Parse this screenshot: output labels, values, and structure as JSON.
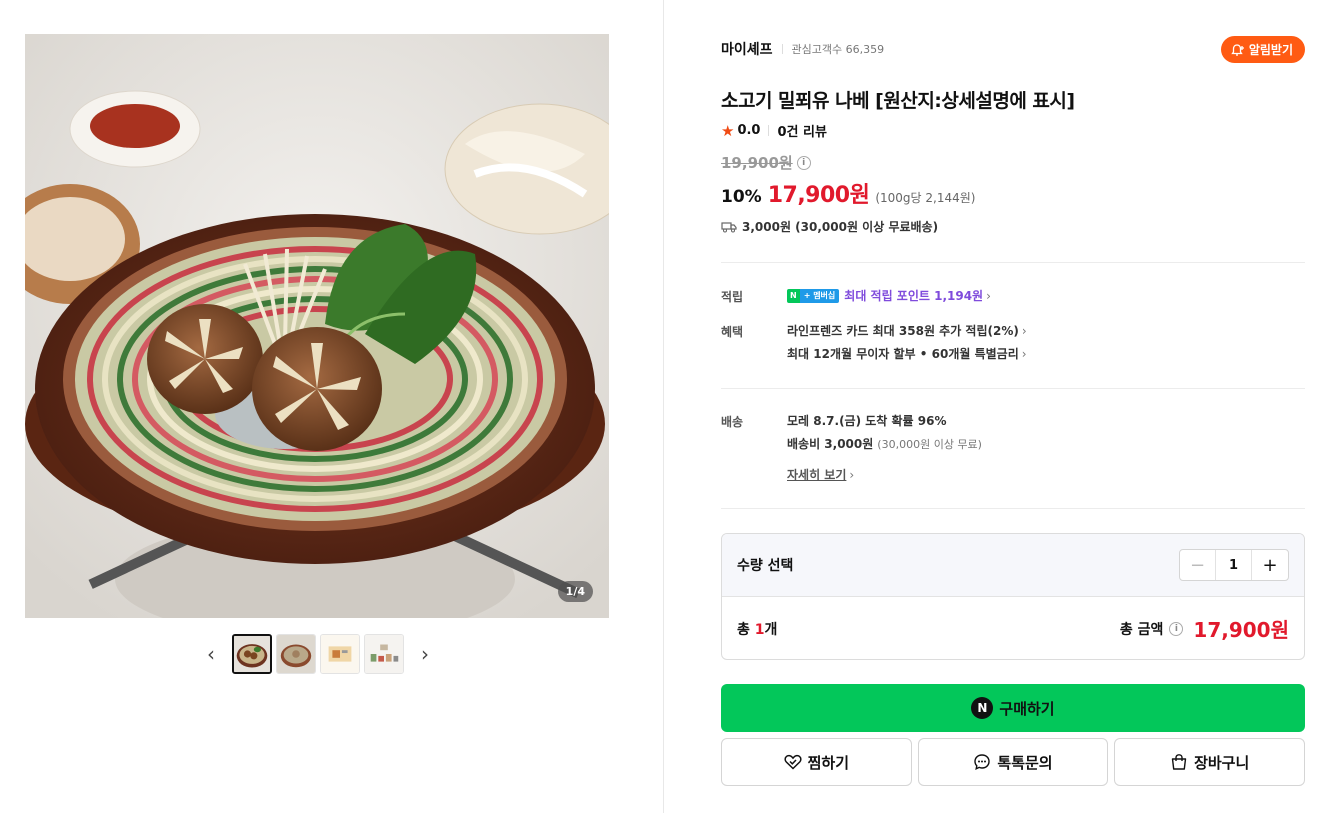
{
  "gallery": {
    "counter": "1/4",
    "thumbnail_count": 4,
    "active_index": 0
  },
  "store": {
    "name": "마이셰프",
    "fans_label": "관심고객수 66,359",
    "alarm_label": "알림받기"
  },
  "product": {
    "title": "소고기 밀푀유 나베 [원산지:상세설명에 표시]",
    "rating": "0.0",
    "reviews": "0건 리뷰",
    "original_price": "19,900원",
    "discount": "10%",
    "price": "17,900원",
    "unit_price": "(100g당 2,144원)",
    "shipping": "3,000원 (30,000원 이상 무료배송)"
  },
  "benefits": {
    "points_label": "적립",
    "badge_n": "N",
    "badge_plus": "+ 멤버십",
    "points_text": "최대 적립 포인트 1,194원",
    "benefit_label": "혜택",
    "benefit_line1": "라인프렌즈 카드 최대 358원 추가 적립(2%)",
    "benefit_line2": "최대 12개월 무이자 할부 • 60개월 특별금리"
  },
  "delivery": {
    "label": "배송",
    "arrival": "모레 8.7.(금) 도착 확률 96%",
    "fee_main": "배송비 3,000원",
    "fee_note": "(30,000원 이상 무료)",
    "detail_link": "자세히 보기"
  },
  "quantity": {
    "label": "수량 선택",
    "value": "1",
    "total_prefix": "총",
    "total_count": "1",
    "total_suffix": "개",
    "total_label": "총 금액",
    "total_price": "17,900원"
  },
  "actions": {
    "buy": "구매하기",
    "wish": "찜하기",
    "talk": "톡톡문의",
    "cart": "장바구니"
  },
  "colors": {
    "accent_green": "#03c75a",
    "price_red": "#e1192c",
    "alarm_orange": "#ff5b13",
    "points_purple": "#7f4bdc"
  }
}
